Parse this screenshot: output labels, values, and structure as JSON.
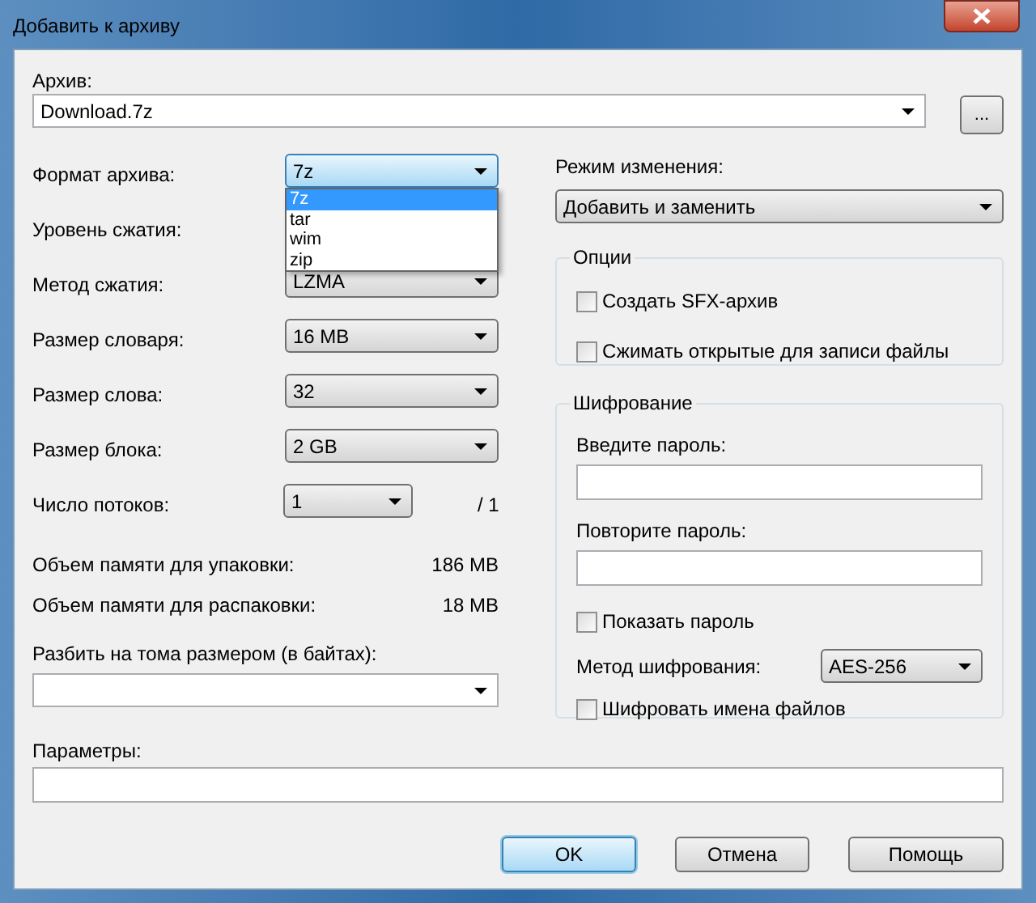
{
  "window": {
    "title": "Добавить к архиву"
  },
  "archive": {
    "label": "Архив:",
    "value": "Download.7z",
    "browse_button": "..."
  },
  "format": {
    "label": "Формат архива:",
    "value": "7z",
    "expanded": true,
    "options": [
      {
        "label": "7z",
        "selected": true
      },
      {
        "label": "tar",
        "selected": false
      },
      {
        "label": "wim",
        "selected": false
      },
      {
        "label": "zip",
        "selected": false
      }
    ]
  },
  "settings": [
    {
      "label": "Уровень сжатия:"
    },
    {
      "label": "Метод сжатия:",
      "value": "LZMA"
    },
    {
      "label": "Размер словаря:",
      "value": "16 MB"
    },
    {
      "label": "Размер слова:",
      "value": "32"
    },
    {
      "label": "Размер блока:",
      "value": "2 GB"
    },
    {
      "label": "Число потоков:",
      "value": "1",
      "suffix": "/ 1"
    }
  ],
  "memory": [
    {
      "label": "Объем памяти для упаковки:",
      "value": "186 MB"
    },
    {
      "label": "Объем памяти для распаковки:",
      "value": "18 MB"
    }
  ],
  "split": {
    "label": "Разбить на тома размером (в байтах):"
  },
  "update_mode": {
    "label": "Режим изменения:",
    "value": "Добавить и заменить"
  },
  "options": {
    "title": "Опции",
    "items": [
      {
        "label": "Создать SFX-архив",
        "checked": false
      },
      {
        "label": "Сжимать открытые для записи файлы",
        "checked": false
      }
    ]
  },
  "encryption": {
    "title": "Шифрование",
    "password_label": "Введите пароль:",
    "repeat_label": "Повторите пароль:",
    "show_password": {
      "label": "Показать пароль",
      "checked": false
    },
    "method": {
      "label": "Метод шифрования:",
      "value": "AES-256"
    },
    "encrypt_names": {
      "label": "Шифровать имена файлов",
      "checked": false
    }
  },
  "parameters": {
    "label": "Параметры:"
  },
  "buttons": [
    {
      "label": "OK",
      "default": true
    },
    {
      "label": "Отмена",
      "default": false
    },
    {
      "label": "Помощь",
      "default": false
    }
  ]
}
